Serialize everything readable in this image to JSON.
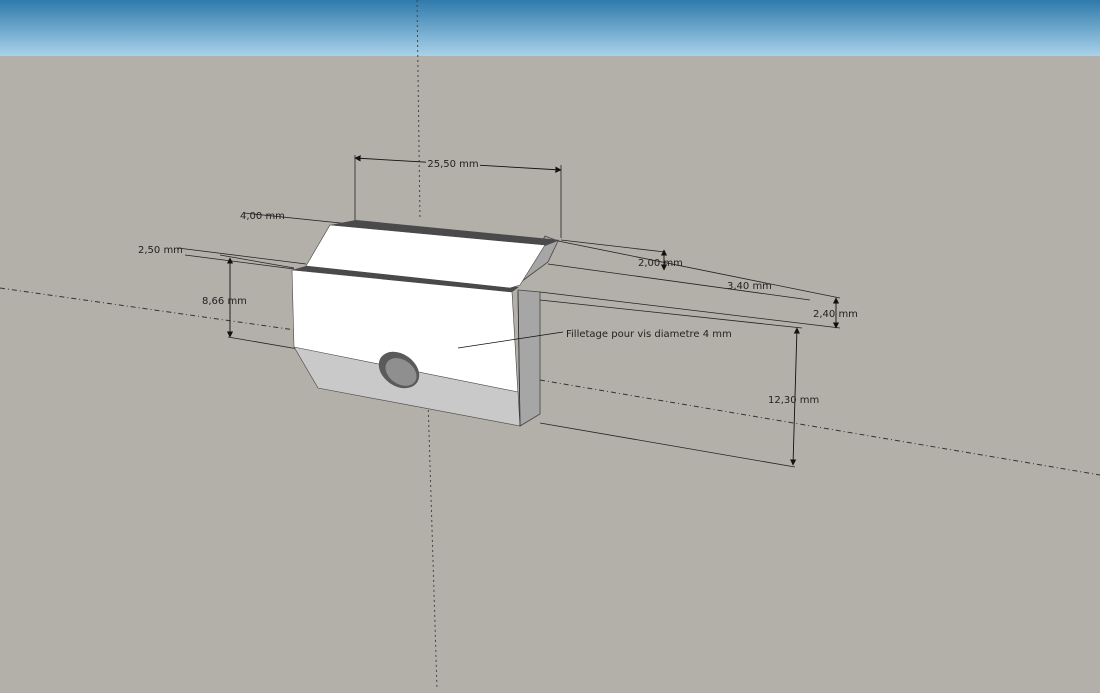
{
  "scene": {
    "sky_top_color": "#2f7aac",
    "sky_bottom_color": "#a9d2ea",
    "ground_color": "#b3b0a9",
    "part_face_color": "#ffffff",
    "part_bottom_color": "#c9c9c9",
    "part_side_color": "#a6a6a6",
    "part_top_edge_color": "#4a4a4a"
  },
  "dimensions": [
    {
      "id": "width",
      "label": "25,50 mm"
    },
    {
      "id": "top-depth",
      "label": "4,00 mm"
    },
    {
      "id": "left-depth",
      "label": "2,50 mm"
    },
    {
      "id": "left-height",
      "label": "8,66 mm"
    },
    {
      "id": "step-height",
      "label": "2,00 mm"
    },
    {
      "id": "step-depth",
      "label": "3,40 mm"
    },
    {
      "id": "flange-height",
      "label": "2,40 mm"
    },
    {
      "id": "total-height",
      "label": "12,30 mm"
    }
  ],
  "annotation": {
    "label": "Filletage pour vis diametre 4 mm"
  }
}
